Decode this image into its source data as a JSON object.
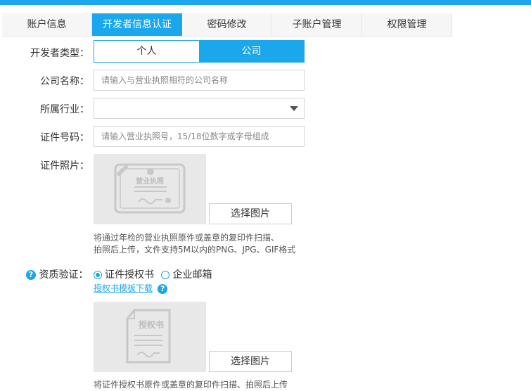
{
  "tabs": [
    {
      "label": "账户信息"
    },
    {
      "label": "开发者信息认证"
    },
    {
      "label": "密码修改"
    },
    {
      "label": "子账户管理"
    },
    {
      "label": "权限管理"
    }
  ],
  "form": {
    "dev_type": {
      "label": "开发者类型：",
      "options": [
        "个人",
        "公司"
      ],
      "selected": "公司"
    },
    "company_name": {
      "label": "公司名称：",
      "placeholder": "请输入与营业执照相符的公司名称"
    },
    "industry": {
      "label": "所属行业：",
      "value": ""
    },
    "cert_number": {
      "label": "证件号码：",
      "placeholder": "请输入营业执照号，15/18位数字或字母组成"
    },
    "cert_photo": {
      "label": "证件照片：",
      "stamp_text": "营业执照",
      "button": "选择图片",
      "hint_line1": "将通过年检的营业执照原件或盖章的复印件扫描、",
      "hint_line2": "拍照后上传，文件支持5M以内的PNG、JPG、GIF格式"
    },
    "qualification": {
      "label": "资质验证：",
      "options": [
        "证件授权书",
        "企业邮箱"
      ],
      "selected": "证件授权书",
      "template_link": "授权书模板下载",
      "doc_text": "授权书",
      "button": "选择图片",
      "hint_cut": "将证件授权书原件或盖章的复印件扫描、拍照后上传"
    }
  },
  "colors": {
    "accent": "#1aa7ec"
  }
}
